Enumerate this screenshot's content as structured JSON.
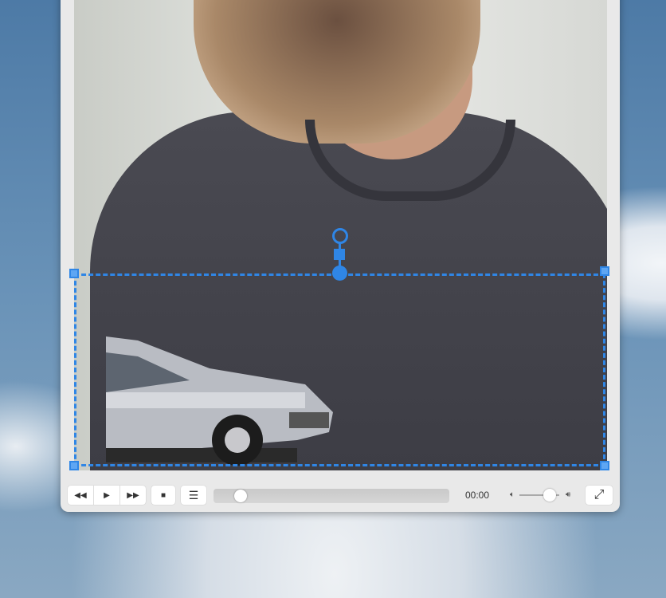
{
  "player": {
    "time": "00:00",
    "progress": 0.05,
    "volume": 0.8,
    "buttons": {
      "rewind": "◀◀",
      "play": "▶",
      "forward": "▶▶",
      "stop": "■",
      "playlist": "☰",
      "fullscreen": "⤢"
    },
    "icons": {
      "volume_low": "🔈︎",
      "volume_high": "🔊︎"
    }
  },
  "colors": {
    "selection": "#2f86e6"
  }
}
